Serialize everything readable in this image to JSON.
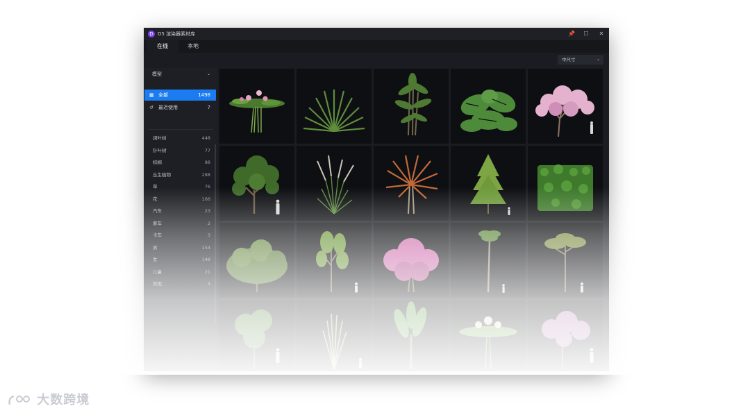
{
  "app": {
    "title": "D5 渲染器素材库",
    "logo_letter": "D"
  },
  "window_controls": {
    "pin": "📌",
    "maximize": "☐",
    "close": "✕"
  },
  "tabs": [
    {
      "label": "在线",
      "active": true
    },
    {
      "label": "本地",
      "active": false
    }
  ],
  "toolbar": {
    "size_select": "中尺寸"
  },
  "sidebar": {
    "category_select": "模型",
    "quick": [
      {
        "label": "全部",
        "count": "1498",
        "icon": "grid-icon",
        "active": true
      },
      {
        "label": "最近使用",
        "count": "7",
        "icon": "history-icon",
        "active": false
      }
    ],
    "categories": [
      {
        "label": "阔叶树",
        "count": "448"
      },
      {
        "label": "针叶树",
        "count": "77"
      },
      {
        "label": "棕榈",
        "count": "88"
      },
      {
        "label": "丛生植物",
        "count": "288"
      },
      {
        "label": "草",
        "count": "76"
      },
      {
        "label": "花",
        "count": "166"
      },
      {
        "label": "汽车",
        "count": "23"
      },
      {
        "label": "客车",
        "count": "2"
      },
      {
        "label": "卡车",
        "count": "3"
      },
      {
        "label": "男",
        "count": "154"
      },
      {
        "label": "女",
        "count": "148"
      },
      {
        "label": "儿童",
        "count": "21"
      },
      {
        "label": "其他",
        "count": "4"
      }
    ]
  },
  "assets": [
    {
      "name": "water-lily",
      "scale_figure": false
    },
    {
      "name": "agave-spiky-plant",
      "scale_figure": false
    },
    {
      "name": "bamboo-palm",
      "scale_figure": false
    },
    {
      "name": "monstera",
      "scale_figure": false
    },
    {
      "name": "cherry-blossom-tree",
      "scale_figure": true
    },
    {
      "name": "deciduous-tree",
      "scale_figure": true
    },
    {
      "name": "pampas-grass",
      "scale_figure": false
    },
    {
      "name": "cordyline-red",
      "scale_figure": false
    },
    {
      "name": "conifer-tree",
      "scale_figure": true
    },
    {
      "name": "hedge-block",
      "scale_figure": false
    },
    {
      "name": "round-bush",
      "scale_figure": false
    },
    {
      "name": "slender-tree",
      "scale_figure": true
    },
    {
      "name": "pink-flowering-shrub",
      "scale_figure": false
    },
    {
      "name": "tall-palm",
      "scale_figure": true
    },
    {
      "name": "umbrella-tree",
      "scale_figure": true
    },
    {
      "name": "leafy-tree-faded",
      "scale_figure": true
    },
    {
      "name": "ornamental-grass-faded",
      "scale_figure": true
    },
    {
      "name": "banana-plant-faded",
      "scale_figure": false
    },
    {
      "name": "flower-cluster-faded",
      "scale_figure": false
    },
    {
      "name": "purple-tree-faded",
      "scale_figure": true
    }
  ],
  "watermark": {
    "text": "大数跨境"
  }
}
